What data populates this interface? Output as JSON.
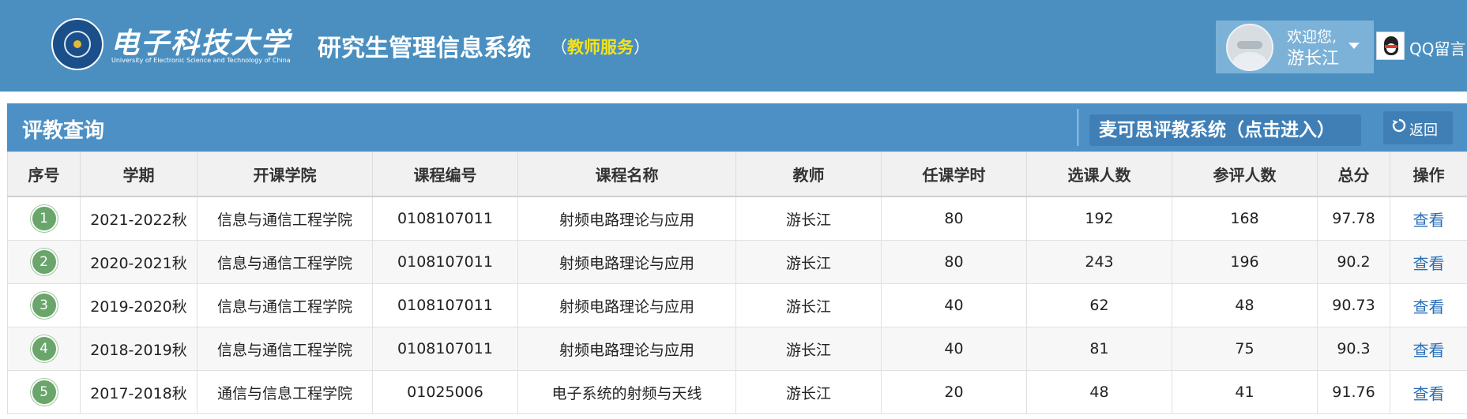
{
  "header": {
    "logo_name": "电子科技大学",
    "logo_subtitle": "University of Electronic Science and Technology of China",
    "system_title": "研究生管理信息系统",
    "system_role_open": "（",
    "system_role": "教师服务",
    "system_role_close": "）",
    "welcome": "欢迎您,",
    "username": "游长江",
    "qq_label": "QQ留言"
  },
  "panel": {
    "title": "评教查询",
    "mycos_label": "麦可思评教系统（点击进入）",
    "back_label": "返回"
  },
  "table": {
    "columns": [
      "序号",
      "学期",
      "开课学院",
      "课程编号",
      "课程名称",
      "教师",
      "任课学时",
      "选课人数",
      "参评人数",
      "总分",
      "操作"
    ],
    "rows": [
      {
        "no": "1",
        "term": "2021-2022秋",
        "college": "信息与通信工程学院",
        "code": "0108107011",
        "name": "射频电路理论与应用",
        "teacher": "游长江",
        "hours": "80",
        "enrolled": "192",
        "rated": "168",
        "score": "97.78",
        "action": "查看"
      },
      {
        "no": "2",
        "term": "2020-2021秋",
        "college": "信息与通信工程学院",
        "code": "0108107011",
        "name": "射频电路理论与应用",
        "teacher": "游长江",
        "hours": "80",
        "enrolled": "243",
        "rated": "196",
        "score": "90.2",
        "action": "查看"
      },
      {
        "no": "3",
        "term": "2019-2020秋",
        "college": "信息与通信工程学院",
        "code": "0108107011",
        "name": "射频电路理论与应用",
        "teacher": "游长江",
        "hours": "40",
        "enrolled": "62",
        "rated": "48",
        "score": "90.73",
        "action": "查看"
      },
      {
        "no": "4",
        "term": "2018-2019秋",
        "college": "信息与通信工程学院",
        "code": "0108107011",
        "name": "射频电路理论与应用",
        "teacher": "游长江",
        "hours": "40",
        "enrolled": "81",
        "rated": "75",
        "score": "90.3",
        "action": "查看"
      },
      {
        "no": "5",
        "term": "2017-2018秋",
        "college": "通信与信息工程学院",
        "code": "01025006",
        "name": "电子系统的射频与天线",
        "teacher": "游长江",
        "hours": "20",
        "enrolled": "48",
        "rated": "41",
        "score": "91.76",
        "action": "查看"
      }
    ]
  },
  "colors": {
    "header_bg": "#4a8fc0",
    "panel_bg": "#4d90c5",
    "role_highlight": "#f5e21a",
    "badge_green": "#6aa56c",
    "link_blue": "#2a6fb8"
  }
}
